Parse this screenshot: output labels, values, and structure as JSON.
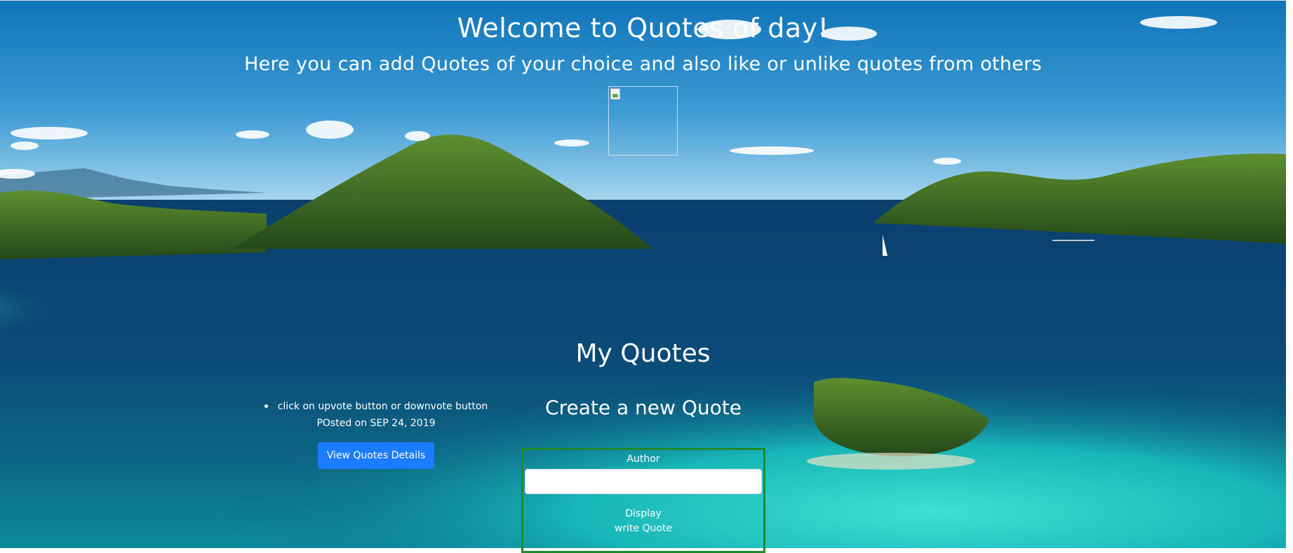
{
  "header": {
    "title": "Welcome to Quotes of day!",
    "subtitle": "Here you can add Quotes of your choice and also like or unlike quotes from others"
  },
  "hero_image": {
    "icon": "broken-image-icon"
  },
  "my_quotes": {
    "heading": "My Quotes",
    "items": [
      {
        "text": "click on upvote button or downvote button"
      }
    ],
    "posted": "POsted on SEP 24, 2019",
    "details_button": "View Quotes Details"
  },
  "create_quote": {
    "heading": "Create a new Quote",
    "author_label": "Author",
    "author_value": "",
    "display_label": "Display",
    "quote_label": "write Quote"
  },
  "colors": {
    "button": "#1a7cff",
    "form_border": "#1f8a2b"
  }
}
